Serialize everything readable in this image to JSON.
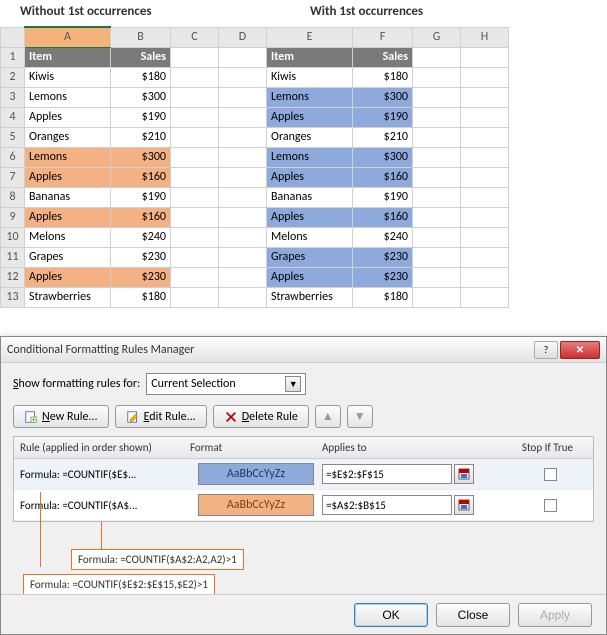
{
  "titles": {
    "without": "Without 1st occurrences",
    "with": "With 1st occurrences"
  },
  "columns": [
    "A",
    "B",
    "C",
    "D",
    "E",
    "F",
    "G",
    "H"
  ],
  "rowNums": [
    "1",
    "2",
    "3",
    "4",
    "5",
    "6",
    "7",
    "8",
    "9",
    "10",
    "11",
    "12",
    "13"
  ],
  "headers": {
    "item": "Item",
    "sales": "Sales"
  },
  "left": [
    {
      "item": "Kiwis",
      "sales": "$180",
      "hl": false
    },
    {
      "item": "Lemons",
      "sales": "$300",
      "hl": false
    },
    {
      "item": "Apples",
      "sales": "$190",
      "hl": false
    },
    {
      "item": "Oranges",
      "sales": "$210",
      "hl": false
    },
    {
      "item": "Lemons",
      "sales": "$300",
      "hl": true
    },
    {
      "item": "Apples",
      "sales": "$160",
      "hl": true
    },
    {
      "item": "Bananas",
      "sales": "$190",
      "hl": false
    },
    {
      "item": "Apples",
      "sales": "$160",
      "hl": true
    },
    {
      "item": "Melons",
      "sales": "$240",
      "hl": false
    },
    {
      "item": "Grapes",
      "sales": "$230",
      "hl": false
    },
    {
      "item": "Apples",
      "sales": "$230",
      "hl": true
    },
    {
      "item": "Strawberries",
      "sales": "$180",
      "hl": false
    }
  ],
  "right": [
    {
      "item": "Kiwis",
      "sales": "$180",
      "hl": false
    },
    {
      "item": "Lemons",
      "sales": "$300",
      "hl": true
    },
    {
      "item": "Apples",
      "sales": "$190",
      "hl": true
    },
    {
      "item": "Oranges",
      "sales": "$210",
      "hl": false
    },
    {
      "item": "Lemons",
      "sales": "$300",
      "hl": true
    },
    {
      "item": "Apples",
      "sales": "$160",
      "hl": true
    },
    {
      "item": "Bananas",
      "sales": "$190",
      "hl": false
    },
    {
      "item": "Apples",
      "sales": "$160",
      "hl": true
    },
    {
      "item": "Melons",
      "sales": "$240",
      "hl": false
    },
    {
      "item": "Grapes",
      "sales": "$230",
      "hl": true
    },
    {
      "item": "Apples",
      "sales": "$230",
      "hl": true
    },
    {
      "item": "Strawberries",
      "sales": "$180",
      "hl": false
    }
  ],
  "dialog": {
    "title": "Conditional Formatting Rules Manager",
    "helpIcon": "?",
    "closeIcon": "✕",
    "showLabel": "Show formatting rules for:",
    "showValue": "Current Selection",
    "buttons": {
      "new": "New Rule...",
      "edit": "Edit Rule...",
      "delete": "Delete Rule"
    },
    "headers": {
      "rule": "Rule (applied in order shown)",
      "format": "Format",
      "applies": "Applies to",
      "stop": "Stop If True"
    },
    "rules": [
      {
        "formula": "Formula: =COUNTIF($E$...",
        "preview": "AaBbCcYyZz",
        "pvclass": "pv1",
        "applies": "=$E$2:$F$15"
      },
      {
        "formula": "Formula: =COUNTIF($A$...",
        "preview": "AaBbCcYyZz",
        "pvclass": "pv2",
        "applies": "=$A$2:$B$15"
      }
    ],
    "callouts": {
      "c1": "Formula: =COUNTIF($A$2:A2,A2)>1",
      "c2": "Formula: =COUNTIF($E$2:$E$15,$E2)>1"
    },
    "footer": {
      "ok": "OK",
      "close": "Close",
      "apply": "Apply"
    }
  }
}
